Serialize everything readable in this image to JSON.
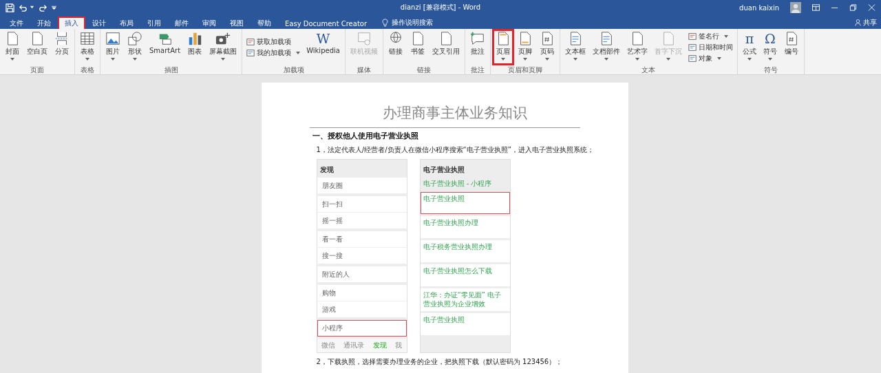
{
  "window": {
    "title": "dianzi [兼容模式] - Word",
    "user": "duan kaixin"
  },
  "quick_access": [
    {
      "kind": "save"
    },
    {
      "kind": "undo",
      "dropdown": true
    },
    {
      "kind": "redo"
    },
    {
      "kind": "more"
    }
  ],
  "tabs": [
    {
      "label": "文件",
      "selected": false,
      "highlighted": false
    },
    {
      "label": "开始",
      "selected": false,
      "highlighted": false
    },
    {
      "label": "插入",
      "selected": true,
      "highlighted": true
    },
    {
      "label": "设计",
      "selected": false,
      "highlighted": false
    },
    {
      "label": "布局",
      "selected": false,
      "highlighted": false
    },
    {
      "label": "引用",
      "selected": false,
      "highlighted": false
    },
    {
      "label": "邮件",
      "selected": false,
      "highlighted": false
    },
    {
      "label": "审阅",
      "selected": false,
      "highlighted": false
    },
    {
      "label": "视图",
      "selected": false,
      "highlighted": false
    },
    {
      "label": "帮助",
      "selected": false,
      "highlighted": false
    },
    {
      "label": "Easy Document Creator",
      "selected": false,
      "highlighted": false
    }
  ],
  "tell_me": "操作说明搜索",
  "share": "共享",
  "ribbon": [
    {
      "label": "页面",
      "items": [
        {
          "kind": "large",
          "label": "封面",
          "dropdown": true,
          "disabled": false,
          "highlighted": false
        },
        {
          "kind": "large",
          "label": "空白页",
          "dropdown": false,
          "disabled": false,
          "highlighted": false
        },
        {
          "kind": "large",
          "label": "分页",
          "dropdown": false,
          "disabled": false,
          "highlighted": false
        }
      ]
    },
    {
      "label": "表格",
      "items": [
        {
          "kind": "large",
          "label": "表格",
          "dropdown": true,
          "disabled": false,
          "highlighted": false
        }
      ]
    },
    {
      "label": "插图",
      "items": [
        {
          "kind": "large",
          "label": "图片",
          "dropdown": true,
          "disabled": false,
          "highlighted": false
        },
        {
          "kind": "large",
          "label": "形状",
          "dropdown": true,
          "disabled": false,
          "highlighted": false
        },
        {
          "kind": "large",
          "label": "SmartArt",
          "dropdown": false,
          "disabled": false,
          "highlighted": false
        },
        {
          "kind": "large",
          "label": "图表",
          "dropdown": false,
          "disabled": false,
          "highlighted": false
        },
        {
          "kind": "large",
          "label": "屏幕截图",
          "dropdown": true,
          "disabled": false,
          "highlighted": false
        }
      ]
    },
    {
      "label": "加载项",
      "items": [
        {
          "kind": "stack",
          "entries": [
            {
              "label": "获取加载项",
              "dropdown": false,
              "disabled": false
            },
            {
              "label": "我的加载项",
              "dropdown": true,
              "disabled": false
            }
          ]
        },
        {
          "kind": "large",
          "label": "Wikipedia",
          "glyph": "W",
          "dropdown": false,
          "disabled": false,
          "highlighted": false
        }
      ]
    },
    {
      "label": "媒体",
      "items": [
        {
          "kind": "large",
          "label": "联机视频",
          "dropdown": false,
          "disabled": true,
          "highlighted": false
        }
      ]
    },
    {
      "label": "链接",
      "items": [
        {
          "kind": "large",
          "label": "链接",
          "dropdown": false,
          "disabled": false,
          "highlighted": false
        },
        {
          "kind": "large",
          "label": "书签",
          "dropdown": false,
          "disabled": false,
          "highlighted": false
        },
        {
          "kind": "large",
          "label": "交叉引用",
          "dropdown": false,
          "disabled": false,
          "highlighted": false
        }
      ]
    },
    {
      "label": "批注",
      "items": [
        {
          "kind": "large",
          "label": "批注",
          "dropdown": false,
          "disabled": false,
          "highlighted": false
        }
      ]
    },
    {
      "label": "页眉和页脚",
      "items": [
        {
          "kind": "large",
          "label": "页眉",
          "dropdown": true,
          "disabled": false,
          "highlighted": true
        },
        {
          "kind": "large",
          "label": "页脚",
          "dropdown": true,
          "disabled": false,
          "highlighted": false
        },
        {
          "kind": "large",
          "label": "页码",
          "dropdown": true,
          "disabled": false,
          "highlighted": false
        }
      ]
    },
    {
      "label": "文本",
      "items": [
        {
          "kind": "large",
          "label": "文本框",
          "dropdown": true,
          "disabled": false,
          "highlighted": false
        },
        {
          "kind": "large",
          "label": "文档部件",
          "dropdown": true,
          "disabled": false,
          "highlighted": false
        },
        {
          "kind": "large",
          "label": "艺术字",
          "dropdown": true,
          "disabled": false,
          "highlighted": false
        },
        {
          "kind": "large",
          "label": "首字下沉",
          "dropdown": true,
          "disabled": true,
          "highlighted": false
        },
        {
          "kind": "stack",
          "entries": [
            {
              "label": "签名行",
              "dropdown": true,
              "disabled": false
            },
            {
              "label": "日期和时间",
              "dropdown": false,
              "disabled": false
            },
            {
              "label": "对象",
              "dropdown": true,
              "disabled": false
            }
          ]
        }
      ]
    },
    {
      "label": "符号",
      "items": [
        {
          "kind": "large",
          "label": "公式",
          "glyph": "π",
          "dropdown": true,
          "disabled": false,
          "highlighted": false
        },
        {
          "kind": "large",
          "label": "符号",
          "glyph": "Ω",
          "dropdown": true,
          "disabled": false,
          "highlighted": false
        },
        {
          "kind": "large",
          "label": "编号",
          "dropdown": false,
          "disabled": false,
          "highlighted": false
        }
      ]
    }
  ],
  "document": {
    "title": "办理商事主体业务知识",
    "heading": "一、授权他人使用电子营业执照",
    "paragraph_1": "1，法定代表人/经营者/负责人在微信小程序搜索“电子营业执照”，进入电子营业执照系统；",
    "paragraph_2": "2，下载执照，选择需要办理业务的企业，把执照下载（默认密码为 123456）；",
    "phone_left": {
      "title": "发现",
      "rows": [
        {
          "label": "朋友圈",
          "gap_after": true,
          "highlighted": false
        },
        {
          "label": "扫一扫",
          "gap_after": false,
          "highlighted": false
        },
        {
          "label": "摇一摇",
          "gap_after": true,
          "highlighted": false
        },
        {
          "label": "看一看",
          "gap_after": false,
          "highlighted": false
        },
        {
          "label": "搜一搜",
          "gap_after": true,
          "highlighted": false
        },
        {
          "label": "附近的人",
          "gap_after": true,
          "highlighted": false
        },
        {
          "label": "购物",
          "gap_after": false,
          "highlighted": false
        },
        {
          "label": "游戏",
          "gap_after": true,
          "highlighted": false
        },
        {
          "label": "小程序",
          "gap_after": false,
          "highlighted": true
        }
      ],
      "tabs": [
        {
          "label": "微信",
          "selected": false
        },
        {
          "label": "通讯录",
          "selected": false
        },
        {
          "label": "发现",
          "selected": true
        },
        {
          "label": "我",
          "selected": false
        }
      ]
    },
    "phone_right": {
      "title": "电子营业执照",
      "section": "电子营业执照 - 小程序",
      "results": [
        {
          "title": "电子营业执照",
          "highlighted": true
        },
        {
          "title": "电子营业执照办理",
          "highlighted": false
        },
        {
          "title": "电子税务营业执照办理",
          "highlighted": false
        },
        {
          "title": "电子营业执照怎么下载",
          "highlighted": false
        },
        {
          "title": "江华：办证“零见面” 电子营业执照为企业增效",
          "highlighted": false
        },
        {
          "title": "电子营业执照",
          "highlighted": false
        }
      ]
    }
  }
}
